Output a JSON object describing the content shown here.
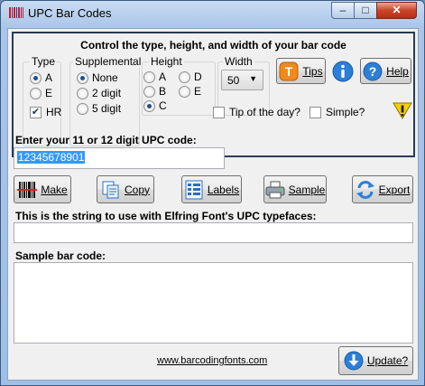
{
  "window": {
    "title": "UPC Bar Codes",
    "minimize": "–",
    "maximize": "□",
    "close": "✕"
  },
  "controls": {
    "heading": "Control the type, height, and width of your bar code",
    "type": {
      "label": "Type",
      "options": [
        "A",
        "E"
      ],
      "selected": "A",
      "hr_label": "HR",
      "hr_checked": true
    },
    "supplemental": {
      "label": "Supplemental",
      "options": [
        "None",
        "2 digit",
        "5 digit"
      ],
      "selected": "None"
    },
    "height": {
      "label": "Height",
      "options": [
        "A",
        "B",
        "C",
        "D",
        "E"
      ],
      "selected": "C"
    },
    "width": {
      "label": "Width",
      "value": "50"
    },
    "tips_label": "Tips",
    "help_label": "Help",
    "tip_of_day_label": "Tip of the day?",
    "tip_of_day_checked": false,
    "simple_label": "Simple?",
    "simple_checked": false
  },
  "upc": {
    "prompt": "Enter your 11 or 12 digit UPC code:",
    "value": "12345678901"
  },
  "actions": {
    "make": "Make",
    "copy": "Copy",
    "labels": "Labels",
    "sample": "Sample",
    "export": "Export"
  },
  "output": {
    "string_label": "This is the string to use with Elfring Font's UPC typefaces:",
    "string_value": "",
    "sample_label": "Sample bar code:"
  },
  "footer": {
    "link": "www.barcodingfonts.com",
    "update_label": "Update?"
  },
  "colors": {
    "accent_blue": "#1f6fd1",
    "tips_orange": "#f08a1e",
    "warning_yellow": "#f5d000"
  }
}
